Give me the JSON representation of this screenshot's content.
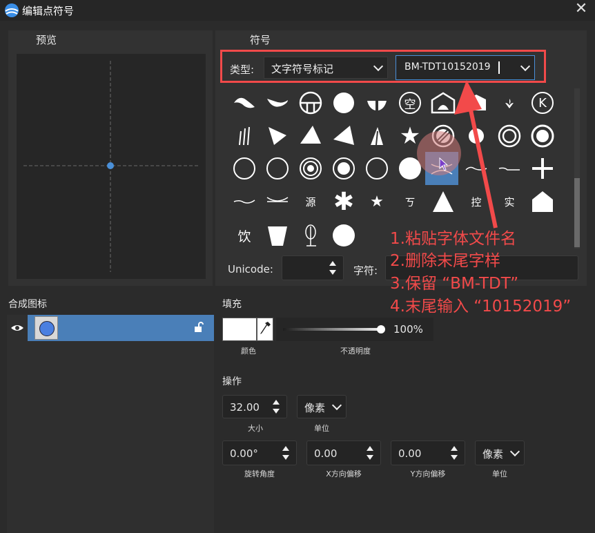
{
  "window": {
    "title": "编辑点符号",
    "close_glyph": "✕"
  },
  "preview": {
    "label": "预览"
  },
  "symbol": {
    "label": "符号",
    "type_label": "类型:",
    "type_value": "文字符号标记",
    "font_value": "BM-TDT10152019",
    "unicode_label": "Unicode:",
    "char_label": "字符:",
    "glyph_text": {
      "g1": "空",
      "g2": "K",
      "g3": "源",
      "g4": "ㄎ",
      "g5": "控",
      "g6": "实",
      "g7": "饮"
    }
  },
  "composite": {
    "label": "合成图标",
    "layer_icon": "circle-icon"
  },
  "fill": {
    "label": "填充",
    "color_label": "颜色",
    "opacity_label": "不透明度",
    "opacity_value": "100%",
    "opacity": 1.0,
    "color": "#ffffff"
  },
  "operation": {
    "label": "操作",
    "size_value": "32.00",
    "size_label": "大小",
    "unit1_value": "像素",
    "unit1_label": "单位",
    "rotation_value": "0.00°",
    "rotation_label": "旋转角度",
    "xoffset_value": "0.00",
    "xoffset_label": "X方向偏移",
    "yoffset_value": "0.00",
    "yoffset_label": "Y方向偏移",
    "unit2_value": "像素",
    "unit2_label": "单位"
  },
  "annotations": [
    "1.粘贴字体文件名",
    "2.删除末尾字样",
    "3.保留 “BM-TDT”",
    "4.末尾输入 “10152019”"
  ],
  "colors": {
    "accent": "#4a90d9",
    "annotation": "#f24a4a",
    "selection": "#4a7fb8"
  }
}
